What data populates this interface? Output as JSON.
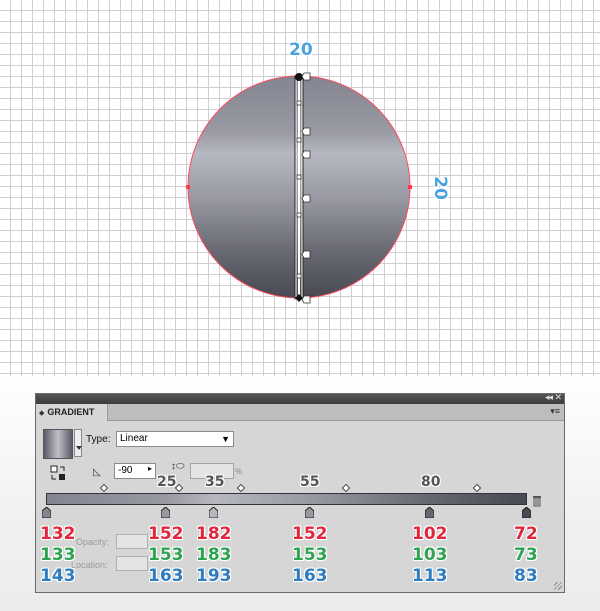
{
  "canvas": {
    "width_label": "20",
    "height_label": "20"
  },
  "gradient_panel": {
    "tab_label": "GRADIENT",
    "type_label": "Type:",
    "type_value": "Linear",
    "angle_value": "-90",
    "aspect_percent": "%",
    "opacity_label": "Opacity:",
    "location_label": "Location:",
    "location_labels": [
      "25",
      "35",
      "55",
      "80"
    ],
    "stops": [
      {
        "r": "132",
        "g": "133",
        "b": "143"
      },
      {
        "r": "152",
        "g": "153",
        "b": "163"
      },
      {
        "r": "182",
        "g": "183",
        "b": "193"
      },
      {
        "r": "152",
        "g": "153",
        "b": "163"
      },
      {
        "r": "102",
        "g": "103",
        "b": "113"
      },
      {
        "r": "72",
        "g": "73",
        "b": "83"
      }
    ]
  },
  "colors": {
    "accent_blue": "#4aa3df",
    "red": "#e0263b",
    "green": "#2fa352",
    "blue": "#2e7dc0"
  }
}
